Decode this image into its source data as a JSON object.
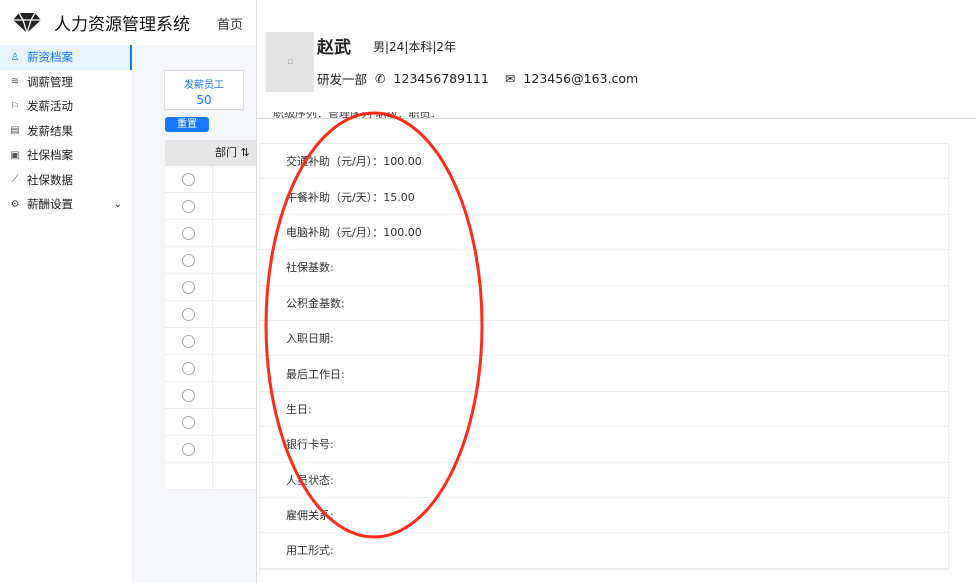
{
  "app": {
    "title": "人力资源管理系统",
    "home": "首页"
  },
  "sidebar": {
    "items": [
      {
        "label": "薪资档案",
        "icon": "user-icon",
        "active": true
      },
      {
        "label": "调薪管理",
        "icon": "layers-icon"
      },
      {
        "label": "发薪活动",
        "icon": "flag-icon"
      },
      {
        "label": "发薪结果",
        "icon": "calculator-icon"
      },
      {
        "label": "社保档案",
        "icon": "file-icon"
      },
      {
        "label": "社保数据",
        "icon": "chart-line-icon"
      },
      {
        "label": "薪酬设置",
        "icon": "settings-icon",
        "expandable": true
      }
    ]
  },
  "list": {
    "stat_label": "发薪员工",
    "stat_value": "50",
    "reset": "重置",
    "col_dept": "部门",
    "sort_icon": "⇅"
  },
  "drawer": {
    "name": "赵武",
    "meta": "男|24|本科|2年",
    "dept": "研发一部",
    "phone": "123456789111",
    "email": "123456@163.com",
    "cut_row": "职级序列：管理序列    职级：职员：",
    "rows": [
      "交通补助（元/月）：100.00",
      "午餐补助（元/天）：15.00",
      "电脑补助（元/月）：100.00",
      "社保基数:",
      "公积金基数:",
      "入职日期:",
      "最后工作日:",
      "生日:",
      "银行卡号:",
      "人员状态:",
      "雇佣关系:",
      "用工形式:"
    ]
  },
  "annotation": {
    "color": "#ff2a1a"
  }
}
